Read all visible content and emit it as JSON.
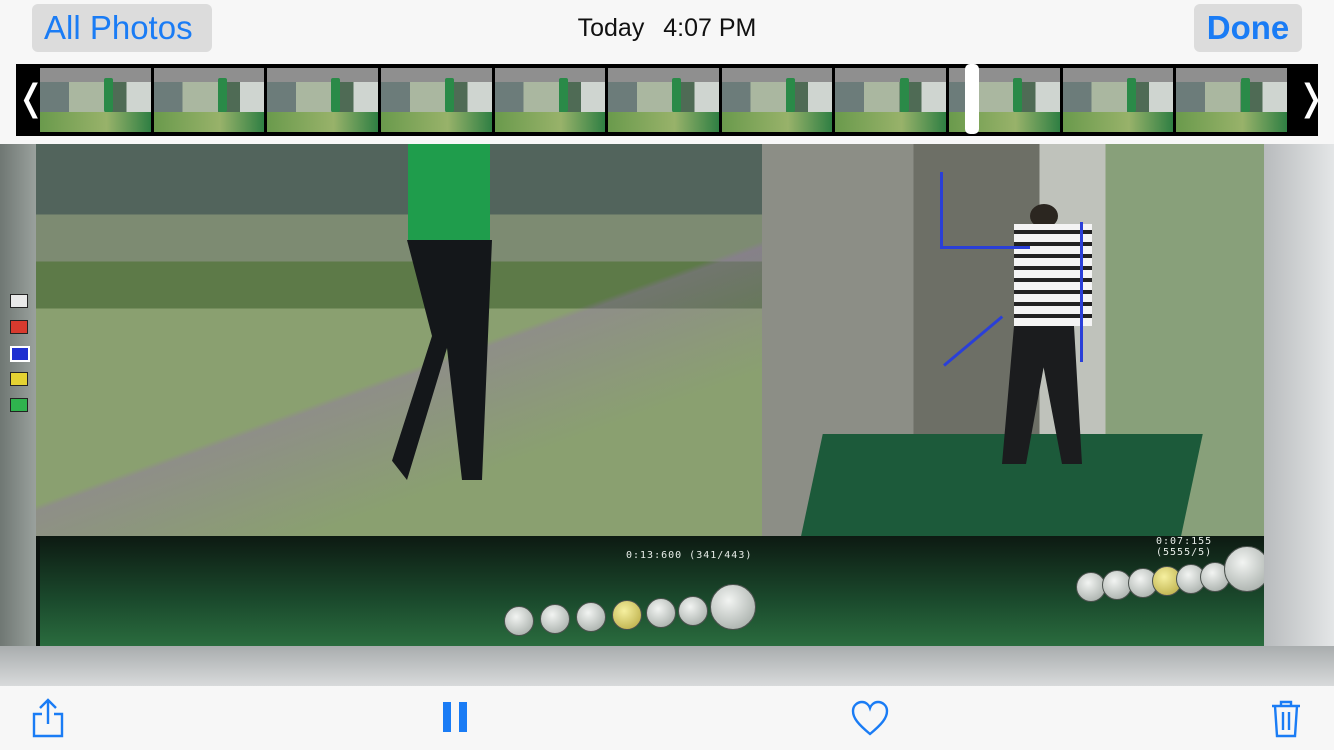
{
  "nav": {
    "back_label": "All Photos",
    "title_day": "Today",
    "title_time": "4:07 PM",
    "done_label": "Done"
  },
  "scrubber": {
    "frame_count": 11,
    "playhead_position": 0.74
  },
  "video": {
    "left_timecode": "0:13:600 (341/443)",
    "right_timecode": "0:07:155 (5555/5)"
  },
  "toolbar": {
    "share_icon": "share-icon",
    "pause_icon": "pause-icon",
    "favorite_icon": "heart-icon",
    "delete_icon": "trash-icon"
  },
  "colors": {
    "accent": "#1a7cf5",
    "nav_button_bg": "#dcdcdc",
    "bar_bg": "#f7f7f7"
  }
}
